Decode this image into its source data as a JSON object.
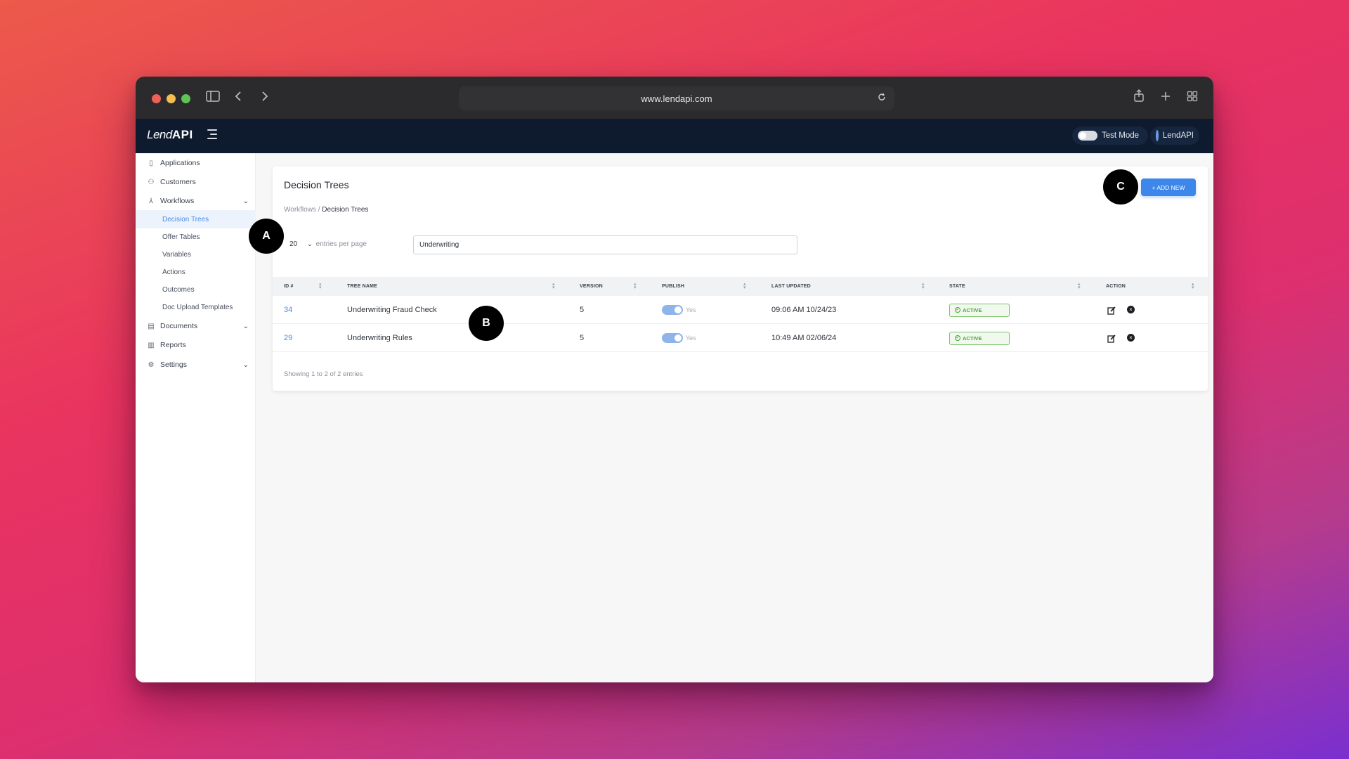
{
  "browser": {
    "url": "www.lendapi.com"
  },
  "app": {
    "logo_lend": "Lend",
    "logo_api": "API",
    "test_mode_label": "Test Mode",
    "account_name": "LendAPI"
  },
  "sidebar": {
    "items": [
      {
        "label": "Applications",
        "icon": "document-icon"
      },
      {
        "label": "Customers",
        "icon": "people-icon"
      },
      {
        "label": "Workflows",
        "icon": "workflow-icon",
        "expanded": true
      },
      {
        "label": "Documents",
        "icon": "documents-icon"
      },
      {
        "label": "Reports",
        "icon": "chart-icon"
      },
      {
        "label": "Settings",
        "icon": "gear-icon"
      }
    ],
    "workflow_subitems": [
      {
        "label": "Decision Trees",
        "active": true
      },
      {
        "label": "Offer Tables"
      },
      {
        "label": "Variables"
      },
      {
        "label": "Actions"
      },
      {
        "label": "Outcomes"
      },
      {
        "label": "Doc Upload Templates"
      }
    ]
  },
  "page": {
    "title": "Decision Trees",
    "breadcrumb_parent": "Workflows",
    "breadcrumb_separator": " / ",
    "breadcrumb_current": "Decision Trees",
    "add_button": "+ ADD NEW",
    "entries_value": "20",
    "entries_label": "entries per page",
    "search_value": "Underwriting",
    "footer": "Showing 1 to 2 of 2 entries"
  },
  "table": {
    "columns": [
      "ID #",
      "TREE NAME",
      "VERSION",
      "PUBLISH",
      "LAST UPDATED",
      "STATE",
      "ACTION"
    ],
    "rows": [
      {
        "id": "34",
        "name": "Underwriting Fraud Check",
        "version": "5",
        "publish": "Yes",
        "updated": "09:06 AM 10/24/23",
        "state": "ACTIVE"
      },
      {
        "id": "29",
        "name": "Underwriting Rules",
        "version": "5",
        "publish": "Yes",
        "updated": "10:49 AM 02/06/24",
        "state": "ACTIVE"
      }
    ]
  },
  "markers": {
    "a": "A",
    "b": "B",
    "c": "C"
  },
  "colors": {
    "accent": "#3d86ea",
    "header_bg": "#0e1a2d",
    "active_green": "#4aa336"
  }
}
